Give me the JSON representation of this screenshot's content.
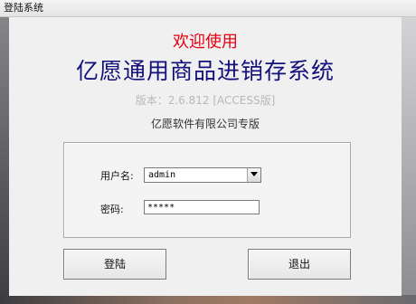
{
  "window": {
    "title": "登陆系统"
  },
  "header": {
    "welcome": "欢迎使用",
    "app_title": "亿愿通用商品进销存系统",
    "version": "版本：2.6.812 [ACCESS版]",
    "company": "亿愿软件有限公司专版"
  },
  "form": {
    "username_label": "用户名:",
    "username_value": "admin",
    "password_label": "密码:",
    "password_value": "*****"
  },
  "buttons": {
    "login": "登陆",
    "exit": "退出"
  },
  "colors": {
    "welcome": "#e60012",
    "app_title": "#12107a",
    "version": "#b8b8b8"
  },
  "icons": {
    "dropdown": "chevron-down-icon"
  }
}
